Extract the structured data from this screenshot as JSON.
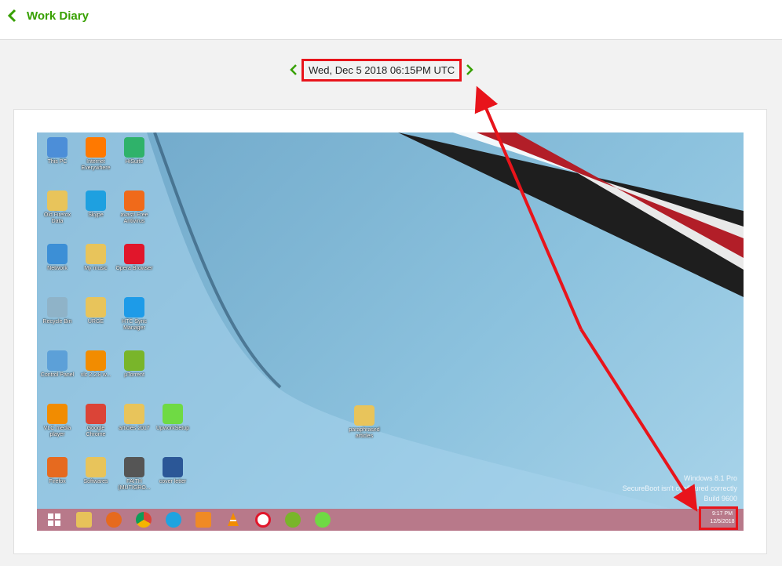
{
  "header": {
    "back_label": "Work Diary"
  },
  "datebar": {
    "label": "Wed, Dec 5 2018 06:15PM UTC"
  },
  "colors": {
    "accent": "#37a000",
    "highlight": "#e8141b"
  },
  "screenshot": {
    "desktop_icons": [
      {
        "label": "This PC",
        "icon": "computer-icon"
      },
      {
        "label": "Internet Everywhere",
        "icon": "orange-icon"
      },
      {
        "label": "HiSuite",
        "icon": "hisuite-icon"
      },
      {
        "label": "Old Firefox Data",
        "icon": "folder-icon"
      },
      {
        "label": "Skype",
        "icon": "skype-icon"
      },
      {
        "label": "avast! Free Antivirus",
        "icon": "avast-icon"
      },
      {
        "label": "Network",
        "icon": "network-icon"
      },
      {
        "label": "My music",
        "icon": "folder-icon"
      },
      {
        "label": "Opera Browser",
        "icon": "opera-icon"
      },
      {
        "label": "Recycle Bin",
        "icon": "recycle-bin-icon"
      },
      {
        "label": "URGE",
        "icon": "folder-icon"
      },
      {
        "label": "HTC Sync Manager",
        "icon": "htc-icon"
      },
      {
        "label": "Control Panel",
        "icon": "control-panel-icon"
      },
      {
        "label": "vlc 2.2.8 w...",
        "icon": "vlc-icon"
      },
      {
        "label": "µTorrent",
        "icon": "utorrent-icon"
      },
      {
        "label": "VLC media player",
        "icon": "vlc-icon"
      },
      {
        "label": "Google Chrome",
        "icon": "chrome-icon"
      },
      {
        "label": "articles 2017",
        "icon": "folder-icon"
      },
      {
        "label": "UpworkSetup",
        "icon": "upwork-icon"
      },
      {
        "label": "Firefox",
        "icon": "firefox-icon"
      },
      {
        "label": "Softwares",
        "icon": "folder-icon"
      },
      {
        "label": "FAITH (MUTIGRO...",
        "icon": "video-file-icon"
      },
      {
        "label": "cover letter",
        "icon": "word-doc-icon"
      },
      {
        "label": "paraphrased articles",
        "icon": "folder-icon"
      }
    ],
    "watermark": [
      "Windows 8.1 Pro",
      "SecureBoot isn't configured correctly",
      "Build 9600"
    ],
    "tray": {
      "time": "9:17 PM",
      "date": "12/5/2018"
    }
  }
}
